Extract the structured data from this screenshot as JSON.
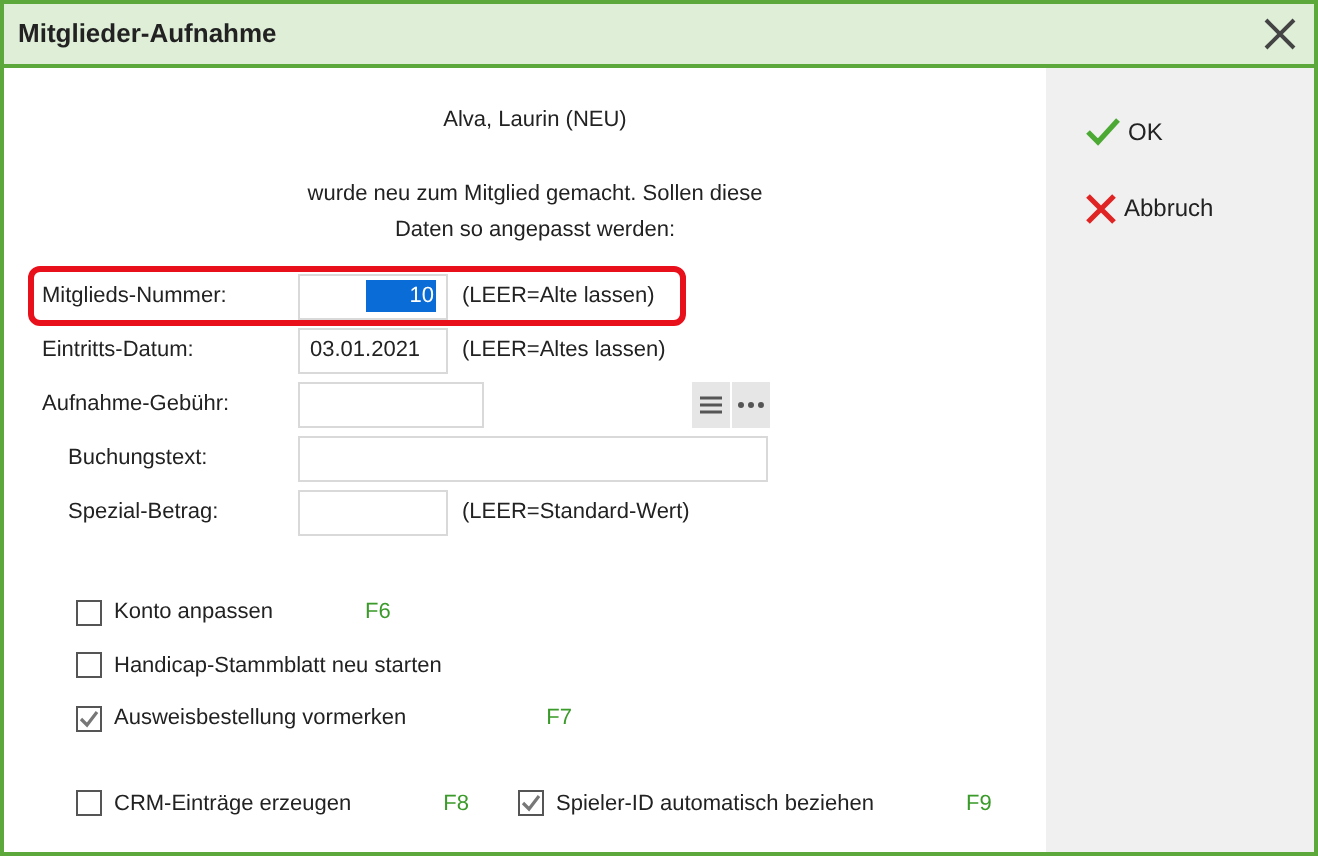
{
  "window": {
    "title": "Mitglieder-Aufnahme"
  },
  "message": [
    "Alva, Laurin (NEU)",
    "wurde neu zum Mitglied gemacht. Sollen diese",
    "Daten so angepasst werden:"
  ],
  "fields": [
    {
      "kind": "number",
      "label": "Mitglieds-Nummer:",
      "value": "10",
      "hint": "(LEER=Alte lassen)",
      "highlighted": true,
      "value_selected": true
    },
    {
      "kind": "date",
      "label": "Eintritts-Datum:",
      "value": "03.01.2021",
      "hint": "(LEER=Altes lassen)",
      "highlighted": false,
      "value_selected": false
    },
    {
      "kind": "fee",
      "label": "Aufnahme-Gebühr:",
      "highlighted": false
    },
    {
      "kind": "text",
      "label": "Buchungstext:",
      "highlighted": false
    },
    {
      "kind": "amount",
      "label": "Spezial-Betrag:",
      "hint": "(LEER=Standard-Wert)",
      "highlighted": false
    }
  ],
  "option_rows": [
    [
      {
        "label": "Konto anpassen",
        "checked": false,
        "shortcut": "F6"
      }
    ],
    [
      {
        "label": "Handicap-Stammblatt neu starten",
        "checked": false
      }
    ],
    [
      {
        "label": "Ausweisbestellung vormerken",
        "checked": true,
        "shortcut": "F7"
      }
    ],
    [
      {
        "label": "CRM-Einträge erzeugen",
        "checked": false,
        "shortcut": "F8"
      },
      {
        "label": "Spieler-ID automatisch beziehen",
        "checked": true,
        "shortcut": "F9"
      }
    ]
  ],
  "buttons": [
    {
      "kind": "ok",
      "label": "OK"
    },
    {
      "kind": "cancel",
      "label": "Abbruch"
    }
  ]
}
